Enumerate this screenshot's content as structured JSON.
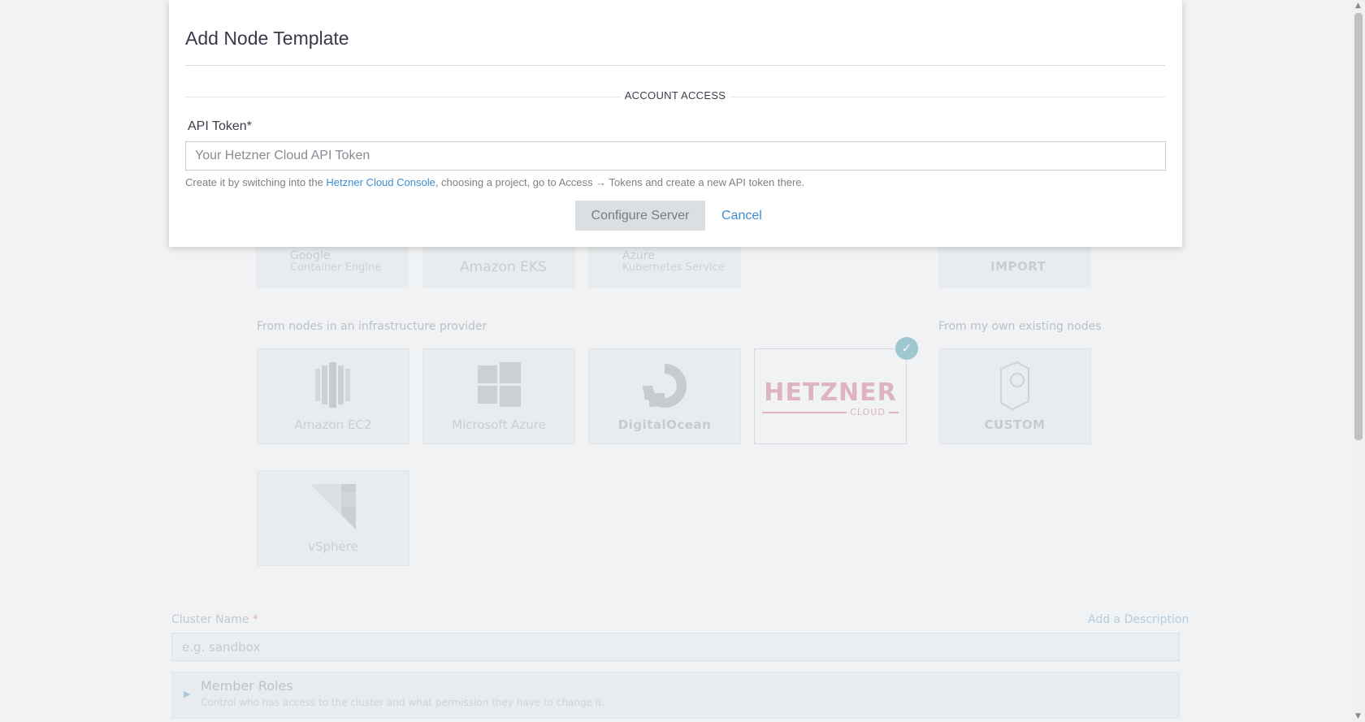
{
  "modal": {
    "title": "Add Node Template",
    "section_heading": "ACCOUNT ACCESS",
    "api_token_label": "API Token*",
    "api_token_placeholder": "Your Hetzner Cloud API Token",
    "api_token_value": "",
    "help_text_before": "Create it by switching into the ",
    "help_link": "Hetzner Cloud Console",
    "help_text_after": ", choosing a project, go to Access → Tokens and create a new API token there.",
    "configure_button": "Configure Server",
    "cancel_button": "Cancel"
  },
  "background": {
    "hosted_tiles": [
      {
        "line1": "Google",
        "line2": "Container Engine"
      },
      {
        "line1": "Amazon EKS",
        "line2": ""
      },
      {
        "line1": "Azure",
        "line2": "Kubernetes Service"
      },
      {
        "line1": "IMPORT",
        "line2": ""
      }
    ],
    "infra_section_label": "From nodes in an infrastructure provider",
    "existing_section_label": "From my own existing nodes",
    "providers": [
      {
        "label": "Amazon EC2",
        "icon": "amazon-ec2-icon"
      },
      {
        "label": "Microsoft Azure",
        "icon": "windows-icon"
      },
      {
        "label": "DigitalOcean",
        "icon": "digitalocean-icon"
      },
      {
        "label": "HETZNER",
        "sub": "CLOUD",
        "selected": true
      },
      {
        "label": "vSphere",
        "icon": "vsphere-icon"
      }
    ],
    "custom_label": "CUSTOM",
    "cluster_name_label": "Cluster Name",
    "cluster_name_required": "*",
    "cluster_name_placeholder": "e.g. sandbox",
    "add_description_link": "Add a Description",
    "member_roles_title": "Member Roles",
    "member_roles_desc": "Control who has access to the cluster and what permission they have to change it."
  }
}
